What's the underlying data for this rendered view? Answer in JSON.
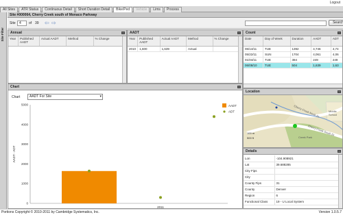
{
  "app": {
    "logout": "Logout"
  },
  "tabs": [
    {
      "label": "All Sites",
      "state": "normal"
    },
    {
      "label": "ATR Status",
      "state": "normal"
    },
    {
      "label": "Continuous Detail",
      "state": "normal"
    },
    {
      "label": "Short Duration Detail",
      "state": "normal"
    },
    {
      "label": "Bike/Ped",
      "state": "active"
    },
    {
      "label": "Vehicle",
      "state": "disabled"
    },
    {
      "label": "Lims",
      "state": "normal"
    },
    {
      "label": "Process",
      "state": "normal"
    }
  ],
  "sidebar": {
    "label": "Site Filter"
  },
  "site": {
    "title": "Site #000064, Cherry Creek south of Monaco Parkway"
  },
  "nav": {
    "site_label": "Site",
    "site_value": "4",
    "of_label": "of",
    "total": "39",
    "search_placeholder": "",
    "search_button": "Search"
  },
  "annual": {
    "title": "Annual",
    "columns": [
      "Year",
      "Published AADT",
      "Actual AADT",
      "Method",
      "% Change"
    ]
  },
  "aadt": {
    "title": "AADT",
    "columns": [
      "Year",
      "Published AADT",
      "Actual AADT",
      "Method",
      "% Change"
    ],
    "rows": [
      [
        "2010",
        "1,600",
        "1,639",
        "Actual",
        ""
      ]
    ]
  },
  "count": {
    "title": "Count",
    "columns": [
      "Date",
      "Day of Week",
      "Duration",
      "AADT",
      "ADT"
    ],
    "rows": [
      [
        "06/14/11",
        "TUE",
        "1392",
        "4,746",
        "4,74"
      ],
      [
        "05/22/11",
        "SUN",
        "1704",
        "4,061",
        "4,06"
      ],
      [
        "01/04/11",
        "TUE",
        "384",
        "249",
        "249"
      ],
      [
        "06/08/10",
        "TUE",
        "504",
        "1,639",
        "1,63"
      ]
    ],
    "selected_index": 3
  },
  "chart_panel": {
    "title": "Chart",
    "chart_label": "Chart",
    "chart_select": "AADT For Site"
  },
  "chart_data": {
    "type": "bar",
    "categories": [
      "2011"
    ],
    "series": [
      {
        "name": "AADT",
        "type": "bar",
        "x": [
          "2010"
        ],
        "values": [
          1639
        ],
        "color": "#f08a00"
      },
      {
        "name": "ADT",
        "type": "scatter",
        "x": [
          "2010",
          "2011",
          "2011.3"
        ],
        "values": [
          1639,
          300,
          4400
        ],
        "color": "#8aa020"
      }
    ],
    "ylabel": "AADT - ADT",
    "ylim": [
      0,
      5000
    ],
    "yticks": [
      0,
      1000,
      2000,
      3000,
      4000,
      5000
    ],
    "xtick_labels": [
      "2011"
    ],
    "legend_position": "top-right"
  },
  "location": {
    "title": "Location",
    "map_labels": [
      "Cherry Creek North Dr",
      "Cherry Creek South Dr",
      "Middle School",
      "Creek Park",
      "Cherry Creek Tr"
    ],
    "scale_top": "100 m",
    "scale_bottom": "500 ft"
  },
  "details": {
    "title": "Details",
    "rows": [
      [
        "Lon",
        "-104.908921"
      ],
      [
        "Lat",
        "39.688285"
      ],
      [
        "City Fips",
        ""
      ],
      [
        "City",
        ""
      ],
      [
        "County Fips",
        "31"
      ],
      [
        "County",
        "Denver"
      ],
      [
        "Region",
        "6"
      ],
      [
        "Functional Class",
        "19 - U Local System"
      ]
    ]
  },
  "status": {
    "copyright": "Portions Copyright © 2010-2011 by Cambridge Systematics, Inc.",
    "version": "Version 1.0.5.7"
  },
  "colors": {
    "selected_row": "#99e6ea",
    "bar": "#f08a00",
    "scatter": "#8aa020",
    "map_green": "#b9cf8f",
    "map_tan": "#e8dfb8"
  }
}
